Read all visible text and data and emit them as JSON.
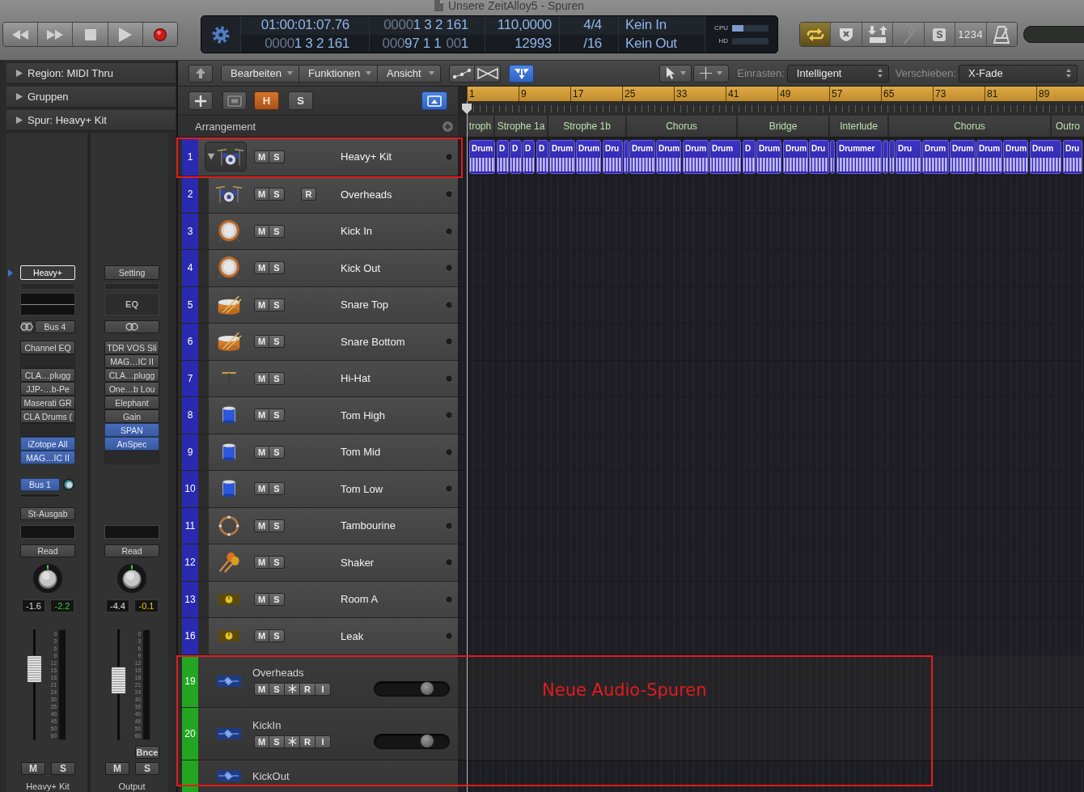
{
  "window": {
    "title": "Unsere ZeitAlloy5 - Spuren"
  },
  "transport": [
    {
      "kind": "rewind"
    },
    {
      "kind": "forward"
    },
    {
      "kind": "stop"
    },
    {
      "kind": "play"
    },
    {
      "kind": "record"
    }
  ],
  "lcd": {
    "columns": [
      {
        "rows": [
          [
            {
              "text": "01:00:01:07.76",
              "dim": false
            }
          ],
          [
            {
              "text": "0000",
              "dim": true
            },
            {
              "text": "1 3 2 161",
              "dim": false
            }
          ]
        ]
      },
      {
        "rows": [
          [
            {
              "text": "0000",
              "dim": true
            },
            {
              "text": "1 3 2 161",
              "dim": false
            }
          ],
          [
            {
              "text": "000",
              "dim": true
            },
            {
              "text": "97 1 1",
              "dim": false
            },
            {
              "text": "00",
              "dim": true
            },
            {
              "text": "1",
              "dim": false
            }
          ]
        ]
      },
      {
        "rows": [
          [
            {
              "text": "110,0000",
              "dim": false
            }
          ],
          [
            {
              "text": "12993",
              "dim": false
            }
          ]
        ]
      },
      {
        "rows": [
          [
            {
              "text": "4/4",
              "dim": false
            }
          ],
          [
            {
              "text": "/16",
              "dim": false
            }
          ]
        ]
      },
      {
        "rows": [
          [
            {
              "text": "Kein In",
              "dim": false
            }
          ],
          [
            {
              "text": "Kein Out",
              "dim": false
            }
          ]
        ]
      }
    ],
    "meters": [
      {
        "label": "CPU",
        "level": 0.3
      },
      {
        "label": "HD"
      }
    ]
  },
  "mode_buttons": [
    {
      "kind": "cycle",
      "on": true
    },
    {
      "kind": "replace",
      "on": false
    },
    {
      "kind": "autopunch",
      "on": false
    },
    {
      "kind": "tuner",
      "on": false
    },
    {
      "kind": "solo",
      "label": "S",
      "on": false
    },
    {
      "kind": "count_in",
      "label": "1234",
      "on": false
    },
    {
      "kind": "metronome",
      "on": false
    }
  ],
  "inspector": {
    "sections": [
      {
        "label": "Region: MIDI Thru",
        "expanded": false
      },
      {
        "label": "Gruppen",
        "expanded": false
      },
      {
        "label": "Spur: Heavy+ Kit",
        "expanded": false
      }
    ],
    "strips": [
      {
        "setting": {
          "label": "Heavy+",
          "selected": true
        },
        "eq": {
          "kind": "curve"
        },
        "input": {
          "linked": true,
          "label": "Bus 4"
        },
        "slots": [
          {
            "kind": "plugin",
            "label": "Channel EQ",
            "highlighted": false
          },
          {
            "kind": "empty"
          },
          {
            "kind": "plugin",
            "label": "CLA…plugg",
            "highlighted": false
          },
          {
            "kind": "plugin",
            "label": "JJP-…b-Pe",
            "highlighted": false
          },
          {
            "kind": "plugin",
            "label": "Maserati GR",
            "highlighted": false
          },
          {
            "kind": "plugin",
            "label": "CLA Drums (",
            "highlighted": false
          },
          {
            "kind": "empty"
          },
          {
            "kind": "plugin",
            "label": "iZotope All",
            "highlighted": true
          },
          {
            "kind": "plugin",
            "label": "MAG…IC II",
            "highlighted": true
          }
        ],
        "send": {
          "label": "Bus 1"
        },
        "output": {
          "label": "St-Ausgab"
        },
        "automation": "Read",
        "volume": "-1.6",
        "peak": {
          "text": "-2.2",
          "warning": false
        },
        "fader": {
          "level": 0.69
        },
        "meter_scale": [
          "0",
          "3",
          "6",
          "9",
          "12",
          "15",
          "18",
          "21",
          "24",
          "30",
          "35",
          "40",
          "45",
          "50",
          "60"
        ],
        "mute": "M",
        "solo": "S",
        "name": "Heavy+ Kit"
      },
      {
        "setting": {
          "label": "Setting",
          "selected": false
        },
        "eq": {
          "kind": "label",
          "label": "EQ"
        },
        "input": {
          "linked": true
        },
        "slots": [
          {
            "kind": "plugin",
            "label": "TDR VOS Sli",
            "highlighted": false
          },
          {
            "kind": "plugin",
            "label": "MAG…IC II",
            "highlighted": false
          },
          {
            "kind": "plugin",
            "label": "CLA…plugg",
            "highlighted": false
          },
          {
            "kind": "plugin",
            "label": "One…b Lou",
            "highlighted": false
          },
          {
            "kind": "plugin",
            "label": "Elephant",
            "highlighted": false
          },
          {
            "kind": "plugin",
            "label": "Gain",
            "highlighted": false
          },
          {
            "kind": "plugin",
            "label": "SPAN",
            "highlighted": true
          },
          {
            "kind": "plugin",
            "label": "AnSpec",
            "highlighted": true
          },
          {
            "kind": "empty"
          }
        ],
        "automation": "Read",
        "volume": "-4.4",
        "peak": {
          "text": "-0.1",
          "warning": true
        },
        "fader": {
          "level": 0.55
        },
        "meter_scale": [
          "0",
          "3",
          "6",
          "9",
          "12",
          "15",
          "18",
          "21",
          "24",
          "30",
          "35",
          "40",
          "45",
          "50",
          "60"
        ],
        "bounce": "Bnce",
        "mute": "M",
        "solo": "S",
        "name": "Output"
      }
    ]
  },
  "track_toolbar": {
    "items": [
      {
        "kind": "up"
      },
      {
        "kind": "menu",
        "label": "Bearbeiten"
      },
      {
        "kind": "menu",
        "label": "Funktionen"
      },
      {
        "kind": "menu",
        "label": "Ansicht"
      },
      {
        "kind": "automation",
        "selected": false
      },
      {
        "kind": "flex",
        "selected": false
      },
      {
        "kind": "catch",
        "selected": true
      }
    ],
    "tools": [
      {
        "kind": "pointer"
      },
      {
        "kind": "crosshair"
      }
    ],
    "snap": {
      "label": "Einrasten:",
      "value": "Intelligent"
    },
    "drag": {
      "label": "Verschieben:",
      "value": "X-Fade"
    }
  },
  "track_header": {
    "buttons": [
      {
        "kind": "add",
        "on": false
      },
      {
        "kind": "stack",
        "on": false
      },
      {
        "kind": "hide",
        "label": "H",
        "on": true
      },
      {
        "kind": "solo",
        "label": "S",
        "on": false
      },
      {
        "kind": "view",
        "on": true
      }
    ],
    "arrangement_label": "Arrangement"
  },
  "ruler": [
    "1",
    "9",
    "17",
    "25",
    "33",
    "41",
    "49",
    "57",
    "65",
    "73",
    "81",
    "89"
  ],
  "arrangement_markers": [
    {
      "label": "troph"
    },
    {
      "label": "Strophe 1a"
    },
    {
      "label": "Strophe 1b"
    },
    {
      "label": "Chorus"
    },
    {
      "label": "Bridge"
    },
    {
      "label": "Interlude"
    },
    {
      "label": "Chorus"
    },
    {
      "label": "Outro"
    }
  ],
  "tracks": [
    {
      "kind": "stack",
      "number": "1",
      "name": "Heavy+ Kit",
      "color": "#2a2ab0",
      "expanded": true,
      "buttons": [
        {
          "kind": "mute",
          "label": "M"
        },
        {
          "kind": "solo",
          "label": "S"
        }
      ],
      "regions": [
        {
          "kind": "midi",
          "label": "Drum"
        },
        {
          "kind": "midi",
          "label": "D"
        },
        {
          "kind": "midi",
          "label": "D"
        },
        {
          "kind": "midi",
          "label": "D"
        },
        {
          "kind": "midi",
          "label": "D"
        },
        {
          "kind": "midi",
          "label": "Drum"
        },
        {
          "kind": "midi",
          "label": "Drum"
        },
        {
          "kind": "midi",
          "label": "Dru"
        },
        {
          "kind": "midi"
        },
        {
          "kind": "midi",
          "label": "Drum"
        },
        {
          "kind": "midi",
          "label": "Drum"
        },
        {
          "kind": "midi",
          "label": "Drum"
        },
        {
          "kind": "midi",
          "label": "Drum"
        },
        {
          "kind": "midi",
          "label": "D"
        },
        {
          "kind": "midi",
          "label": "Drum"
        },
        {
          "kind": "midi",
          "label": "Drum"
        },
        {
          "kind": "midi",
          "label": "Dru"
        },
        {
          "kind": "midi"
        },
        {
          "kind": "midi",
          "label": "Drummer"
        },
        {
          "kind": "midi"
        },
        {
          "kind": "midi"
        },
        {
          "kind": "midi",
          "label": "Dru"
        },
        {
          "kind": "midi",
          "label": "Drum"
        },
        {
          "kind": "midi",
          "label": "Drum"
        },
        {
          "kind": "midi",
          "label": "Drum"
        },
        {
          "kind": "midi",
          "label": "Drum"
        },
        {
          "kind": "midi",
          "label": "Drum"
        },
        {
          "kind": "midi",
          "label": "Dru"
        }
      ],
      "children": [
        {
          "kind": "midi",
          "number": "2",
          "name": "Overheads",
          "color": "#2a2ab0",
          "buttons": [
            {
              "kind": "mute",
              "label": "M"
            },
            {
              "kind": "solo",
              "label": "S"
            },
            {
              "kind": "record",
              "label": "R"
            }
          ]
        },
        {
          "kind": "midi",
          "number": "3",
          "name": "Kick In",
          "color": "#2a2ab0",
          "buttons": [
            {
              "kind": "mute",
              "label": "M"
            },
            {
              "kind": "solo",
              "label": "S"
            }
          ]
        },
        {
          "kind": "midi",
          "number": "4",
          "name": "Kick Out",
          "color": "#2a2ab0",
          "buttons": [
            {
              "kind": "mute",
              "label": "M"
            },
            {
              "kind": "solo",
              "label": "S"
            }
          ]
        },
        {
          "kind": "midi",
          "number": "5",
          "name": "Snare Top",
          "color": "#2a2ab0",
          "buttons": [
            {
              "kind": "mute",
              "label": "M"
            },
            {
              "kind": "solo",
              "label": "S"
            }
          ]
        },
        {
          "kind": "midi",
          "number": "6",
          "name": "Snare Bottom",
          "color": "#2a2ab0",
          "buttons": [
            {
              "kind": "mute",
              "label": "M"
            },
            {
              "kind": "solo",
              "label": "S"
            }
          ]
        },
        {
          "kind": "midi",
          "number": "7",
          "name": "Hi-Hat",
          "color": "#2a2ab0",
          "buttons": [
            {
              "kind": "mute",
              "label": "M"
            },
            {
              "kind": "solo",
              "label": "S"
            }
          ]
        },
        {
          "kind": "midi",
          "number": "8",
          "name": "Tom High",
          "color": "#2a2ab0",
          "buttons": [
            {
              "kind": "mute",
              "label": "M"
            },
            {
              "kind": "solo",
              "label": "S"
            }
          ]
        },
        {
          "kind": "midi",
          "number": "9",
          "name": "Tom Mid",
          "color": "#2a2ab0",
          "buttons": [
            {
              "kind": "mute",
              "label": "M"
            },
            {
              "kind": "solo",
              "label": "S"
            }
          ]
        },
        {
          "kind": "midi",
          "number": "10",
          "name": "Tom Low",
          "color": "#2a2ab0",
          "buttons": [
            {
              "kind": "mute",
              "label": "M"
            },
            {
              "kind": "solo",
              "label": "S"
            }
          ]
        },
        {
          "kind": "midi",
          "number": "11",
          "name": "Tambourine",
          "color": "#2a2ab0",
          "buttons": [
            {
              "kind": "mute",
              "label": "M"
            },
            {
              "kind": "solo",
              "label": "S"
            }
          ]
        },
        {
          "kind": "midi",
          "number": "12",
          "name": "Shaker",
          "color": "#2a2ab0",
          "buttons": [
            {
              "kind": "mute",
              "label": "M"
            },
            {
              "kind": "solo",
              "label": "S"
            }
          ]
        },
        {
          "kind": "midi",
          "number": "13",
          "name": "Room A",
          "color": "#2a2ab0",
          "buttons": [
            {
              "kind": "mute",
              "label": "M"
            },
            {
              "kind": "solo",
              "label": "S"
            }
          ]
        },
        {
          "kind": "midi",
          "number": "16",
          "name": "Leak",
          "color": "#2a2ab0",
          "buttons": [
            {
              "kind": "mute",
              "label": "M"
            },
            {
              "kind": "solo",
              "label": "S"
            }
          ]
        }
      ]
    },
    {
      "kind": "audio",
      "number": "19",
      "name": "Overheads",
      "color": "#22a622",
      "buttons": [
        {
          "kind": "mute",
          "label": "M"
        },
        {
          "kind": "solo",
          "label": "S"
        },
        {
          "kind": "freeze"
        },
        {
          "kind": "record",
          "label": "R"
        },
        {
          "kind": "input",
          "label": "I"
        }
      ],
      "volume": {
        "level": 0.75
      }
    },
    {
      "kind": "audio",
      "number": "20",
      "name": "KickIn",
      "color": "#22a622",
      "buttons": [
        {
          "kind": "mute",
          "label": "M"
        },
        {
          "kind": "solo",
          "label": "S"
        },
        {
          "kind": "freeze"
        },
        {
          "kind": "record",
          "label": "R"
        },
        {
          "kind": "input",
          "label": "I"
        }
      ],
      "volume": {
        "level": 0.75
      }
    },
    {
      "kind": "audio",
      "name": "KickOut",
      "color": "#22a622"
    }
  ],
  "annotations": [
    {
      "kind": "frame"
    },
    {
      "kind": "frame",
      "label": "Neue Audio-Spuren"
    }
  ]
}
